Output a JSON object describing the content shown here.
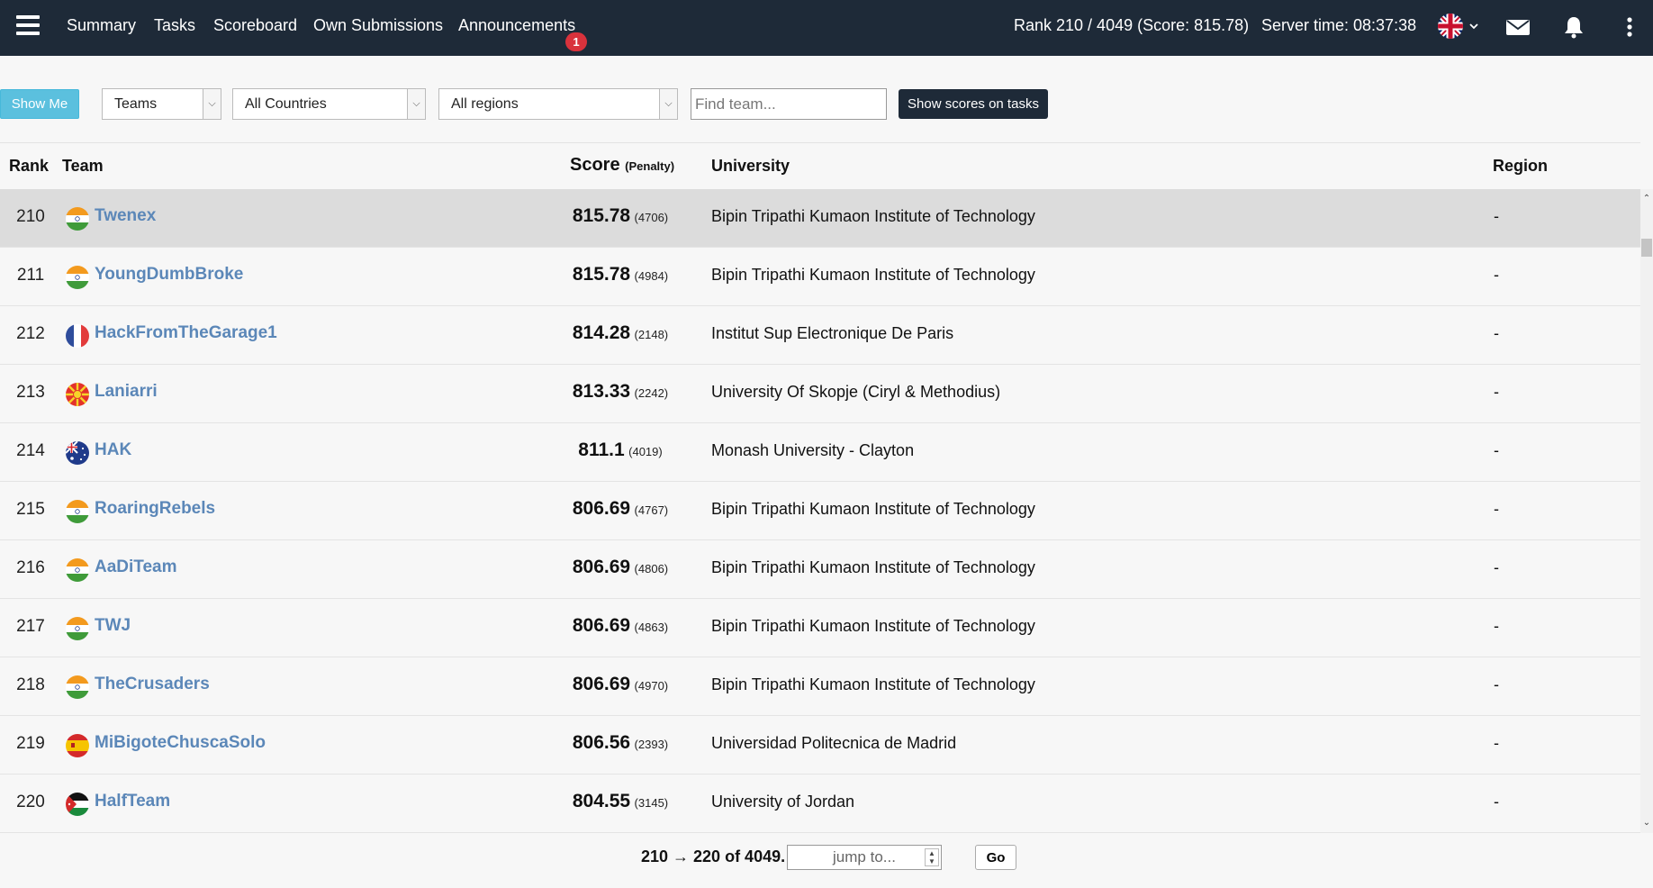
{
  "nav": {
    "items": [
      "Summary",
      "Tasks",
      "Scoreboard",
      "Own Submissions",
      "Announcements"
    ],
    "announcements_badge": "1",
    "rank_info": "Rank 210 / 4049 (Score: 815.78)",
    "server_time": "Server time: 08:37:38",
    "language_flag": "uk-flag-icon",
    "icons": [
      "menu-icon",
      "mail-icon",
      "bell-icon",
      "kebab-icon"
    ]
  },
  "filters": {
    "show_me_label": "Show Me",
    "entity_select": "Teams",
    "country_select": "All Countries",
    "region_select": "All regions",
    "find_placeholder": "Find team...",
    "show_scores_label": "Show scores on tasks"
  },
  "table": {
    "headers": {
      "rank": "Rank",
      "team": "Team",
      "score": "Score",
      "penalty": "(Penalty)",
      "university": "University",
      "region": "Region"
    },
    "rows": [
      {
        "rank": "210",
        "flag": "in",
        "team": "Twenex",
        "score": "815.78",
        "penalty": "(4706)",
        "university": "Bipin Tripathi Kumaon Institute of Technology",
        "region": "-",
        "highlighted": true
      },
      {
        "rank": "211",
        "flag": "in",
        "team": "YoungDumbBroke",
        "score": "815.78",
        "penalty": "(4984)",
        "university": "Bipin Tripathi Kumaon Institute of Technology",
        "region": "-"
      },
      {
        "rank": "212",
        "flag": "fr",
        "team": "HackFromTheGarage1",
        "score": "814.28",
        "penalty": "(2148)",
        "university": "Institut Sup Electronique De Paris",
        "region": "-"
      },
      {
        "rank": "213",
        "flag": "mk",
        "team": "Laniarri",
        "score": "813.33",
        "penalty": "(2242)",
        "university": "University Of Skopje (Ciryl & Methodius)",
        "region": "-"
      },
      {
        "rank": "214",
        "flag": "au",
        "team": "HAK",
        "score": "811.1",
        "penalty": "(4019)",
        "university": "Monash University - Clayton",
        "region": "-"
      },
      {
        "rank": "215",
        "flag": "in",
        "team": "RoaringRebels",
        "score": "806.69",
        "penalty": "(4767)",
        "university": "Bipin Tripathi Kumaon Institute of Technology",
        "region": "-"
      },
      {
        "rank": "216",
        "flag": "in",
        "team": "AaDiTeam",
        "score": "806.69",
        "penalty": "(4806)",
        "university": "Bipin Tripathi Kumaon Institute of Technology",
        "region": "-"
      },
      {
        "rank": "217",
        "flag": "in",
        "team": "TWJ",
        "score": "806.69",
        "penalty": "(4863)",
        "university": "Bipin Tripathi Kumaon Institute of Technology",
        "region": "-"
      },
      {
        "rank": "218",
        "flag": "in",
        "team": "TheCrusaders",
        "score": "806.69",
        "penalty": "(4970)",
        "university": "Bipin Tripathi Kumaon Institute of Technology",
        "region": "-"
      },
      {
        "rank": "219",
        "flag": "es",
        "team": "MiBigoteChuscaSolo",
        "score": "806.56",
        "penalty": "(2393)",
        "university": "Universidad Politecnica de Madrid",
        "region": "-"
      },
      {
        "rank": "220",
        "flag": "jo",
        "team": "HalfTeam",
        "score": "804.55",
        "penalty": "(3145)",
        "university": "University of Jordan",
        "region": "-"
      }
    ]
  },
  "pagination": {
    "range_text": "210 → 220 of 4049.",
    "jump_placeholder": "jump to...",
    "go_label": "Go"
  },
  "colors": {
    "navbar": "#1e2a38",
    "team_link": "#5b87b8",
    "highlight_row": "#dcdcdc",
    "show_me": "#5bc0de",
    "badge": "#d9323c"
  }
}
